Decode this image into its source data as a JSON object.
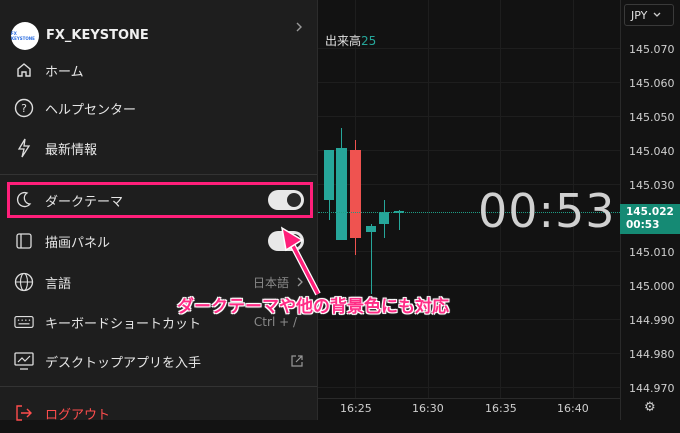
{
  "chart": {
    "currency_button": "JPY",
    "volume_label": "出来高",
    "volume_value": "25",
    "countdown": "00:53",
    "current_price": "145.022",
    "current_timer": "00:53",
    "price_labels": [
      "145.070",
      "145.060",
      "145.050",
      "145.040",
      "145.030",
      "145.010",
      "145.000",
      "144.990",
      "144.980",
      "144.970"
    ],
    "time_labels": [
      "16:25",
      "16:30",
      "16:35",
      "16:40"
    ]
  },
  "menu": {
    "username": "FX_KEYSTONE",
    "avatar_text": "FX KEYSTONE",
    "items": [
      {
        "label": "ホーム",
        "icon": "home-icon"
      },
      {
        "label": "ヘルプセンター",
        "icon": "help-icon"
      },
      {
        "label": "最新情報",
        "icon": "lightning-icon"
      },
      {
        "label": "ダークテーマ",
        "icon": "moon-icon"
      },
      {
        "label": "描画パネル",
        "icon": "panel-icon"
      },
      {
        "label": "言語",
        "icon": "globe-icon",
        "value": "日本語"
      },
      {
        "label": "キーボードショートカット",
        "icon": "keyboard-icon",
        "value": "Ctrl + /"
      },
      {
        "label": "デスクトップアプリを入手",
        "icon": "desktop-icon"
      },
      {
        "label": "ログアウト",
        "icon": "logout-icon"
      }
    ]
  },
  "annotation": "ダークテーマや他の背景色にも対応",
  "colors": {
    "accent": "#ff1f7a",
    "bull": "#26a69a",
    "bear": "#ef5350"
  }
}
